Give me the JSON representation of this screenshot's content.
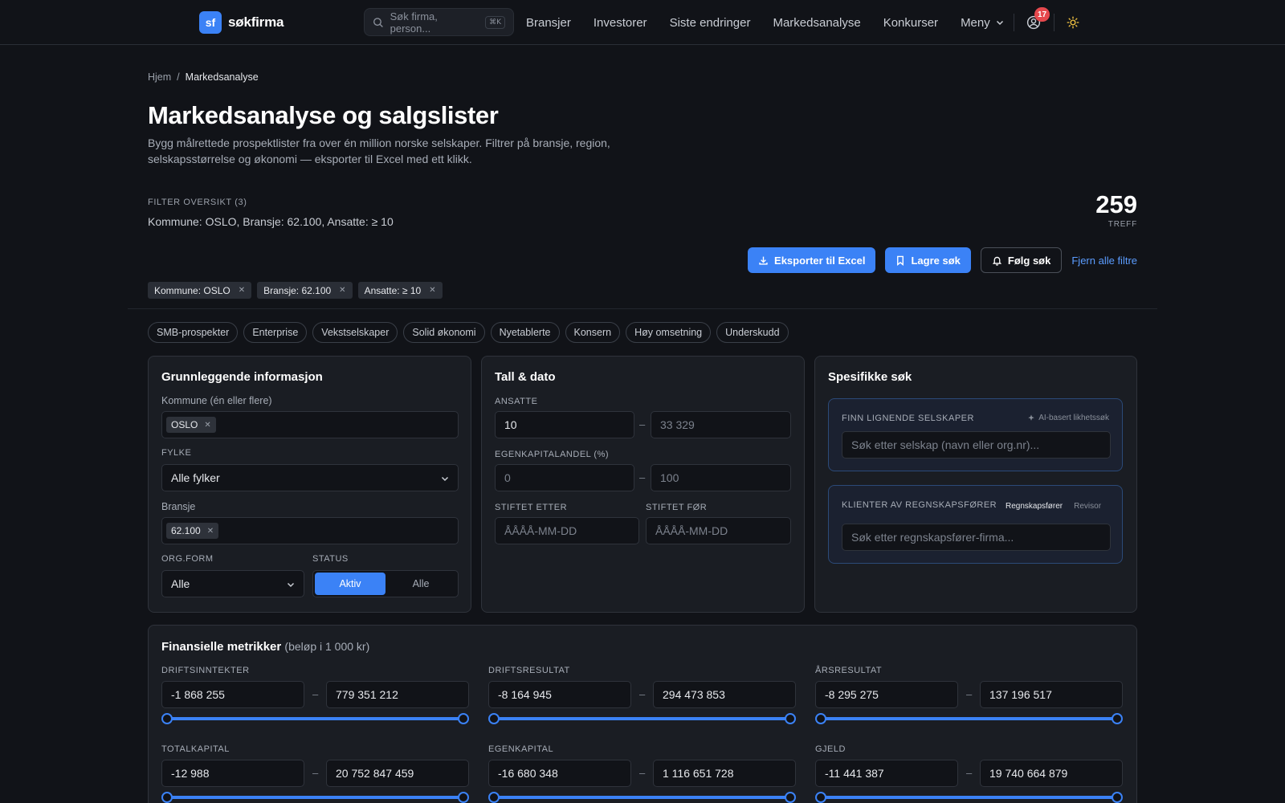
{
  "nav": {
    "logo_mark": "sf",
    "brand": "søkfirma",
    "search_placeholder": "Søk firma, person...",
    "search_shortcut": "⌘K",
    "links": [
      "Bransjer",
      "Investorer",
      "Siste endringer",
      "Markedsanalyse",
      "Konkurser"
    ],
    "menu_label": "Meny",
    "notification_count": "17"
  },
  "breadcrumb": {
    "home": "Hjem",
    "sep": "/",
    "current": "Markedsanalyse"
  },
  "page": {
    "title": "Markedsanalyse og salgslister",
    "description": "Bygg målrettede prospektlister fra over én million norske selskaper. Filtrer på bransje, region, selskapsstørrelse og økonomi — eksporter til Excel med ett klikk."
  },
  "filter_overview": {
    "label": "FILTER OVERSIKT (3)",
    "text": "Kommune: OSLO, Bransje: 62.100, Ansatte: ≥ 10",
    "hits": "259",
    "hits_label": "TREFF"
  },
  "actions": {
    "export": "Eksporter til Excel",
    "save": "Lagre søk",
    "follow": "Følg søk",
    "clear": "Fjern alle filtre"
  },
  "active_filters": [
    "Kommune: OSLO",
    "Bransje: 62.100",
    "Ansatte: ≥ 10"
  ],
  "presets": [
    "SMB-prospekter",
    "Enterprise",
    "Vekstselskaper",
    "Solid økonomi",
    "Nyetablerte",
    "Konsern",
    "Høy omsetning",
    "Underskudd"
  ],
  "basic": {
    "title": "Grunnleggende informasjon",
    "kommune_label": "Kommune (én eller flere)",
    "kommune_tag": "OSLO",
    "fylke_label": "FYLKE",
    "fylke_value": "Alle fylker",
    "bransje_label": "Bransje",
    "bransje_tag": "62.100",
    "orgform_label": "ORG.FORM",
    "orgform_value": "Alle",
    "status_label": "STATUS",
    "status_options": [
      "Aktiv",
      "Alle"
    ],
    "status_selected": "Aktiv"
  },
  "numbers": {
    "title": "Tall & dato",
    "ansatte_label": "ANSATTE",
    "ansatte_min": "10",
    "ansatte_max_placeholder": "33 329",
    "egenkap_label": "EGENKAPITALANDEL (%)",
    "egenkap_min_placeholder": "0",
    "egenkap_max_placeholder": "100",
    "stiftet_etter_label": "STIFTET ETTER",
    "stiftet_for_label": "STIFTET FØR",
    "date_placeholder": "ÅÅÅÅ-MM-DD",
    "range_sep": "–"
  },
  "specific": {
    "title": "Spesifikke søk",
    "similar_label": "FINN LIGNENDE SELSKAPER",
    "similar_note": "AI-basert likhetssøk",
    "similar_placeholder": "Søk etter selskap (navn eller org.nr)...",
    "accountant_label": "KLIENTER AV REGNSKAPSFØRER",
    "accountant_tabs": [
      "Regnskapsfører",
      "Revisor"
    ],
    "accountant_placeholder": "Søk etter regnskapsfører-firma..."
  },
  "financial": {
    "title": "Finansielle metrikker",
    "subtitle": "(beløp i 1 000 kr)",
    "range_sep": "–",
    "metrics": [
      {
        "label": "DRIFTSINNTEKTER",
        "min": "-1 868 255",
        "max": "779 351 212",
        "slider_low": 0,
        "slider_high": 1
      },
      {
        "label": "DRIFTSRESULTAT",
        "min": "-8 164 945",
        "max": "294 473 853",
        "slider_low": 0,
        "slider_high": 1
      },
      {
        "label": "ÅRSRESULTAT",
        "min": "-8 295 275",
        "max": "137 196 517",
        "slider_low": 0,
        "slider_high": 1
      },
      {
        "label": "TOTALKAPITAL",
        "min": "-12 988",
        "max": "20 752 847 459",
        "slider_low": 0,
        "slider_high": 1
      },
      {
        "label": "EGENKAPITAL",
        "min": "-16 680 348",
        "max": "1 116 651 728",
        "slider_low": 0,
        "slider_high": 1
      },
      {
        "label": "GJELD",
        "min": "-11 441 387",
        "max": "19 740 664 879",
        "slider_low": 0,
        "slider_high": 1
      }
    ]
  },
  "colors": {
    "accent": "#3b82f6",
    "background": "#111318",
    "card": "#1a1d23",
    "badge": "#e5484d"
  },
  "icons": [
    "search-icon",
    "chevron-down-icon",
    "user-icon",
    "sun-icon",
    "download-icon",
    "bookmark-icon",
    "bell-icon",
    "close-icon",
    "sparkle-icon"
  ]
}
